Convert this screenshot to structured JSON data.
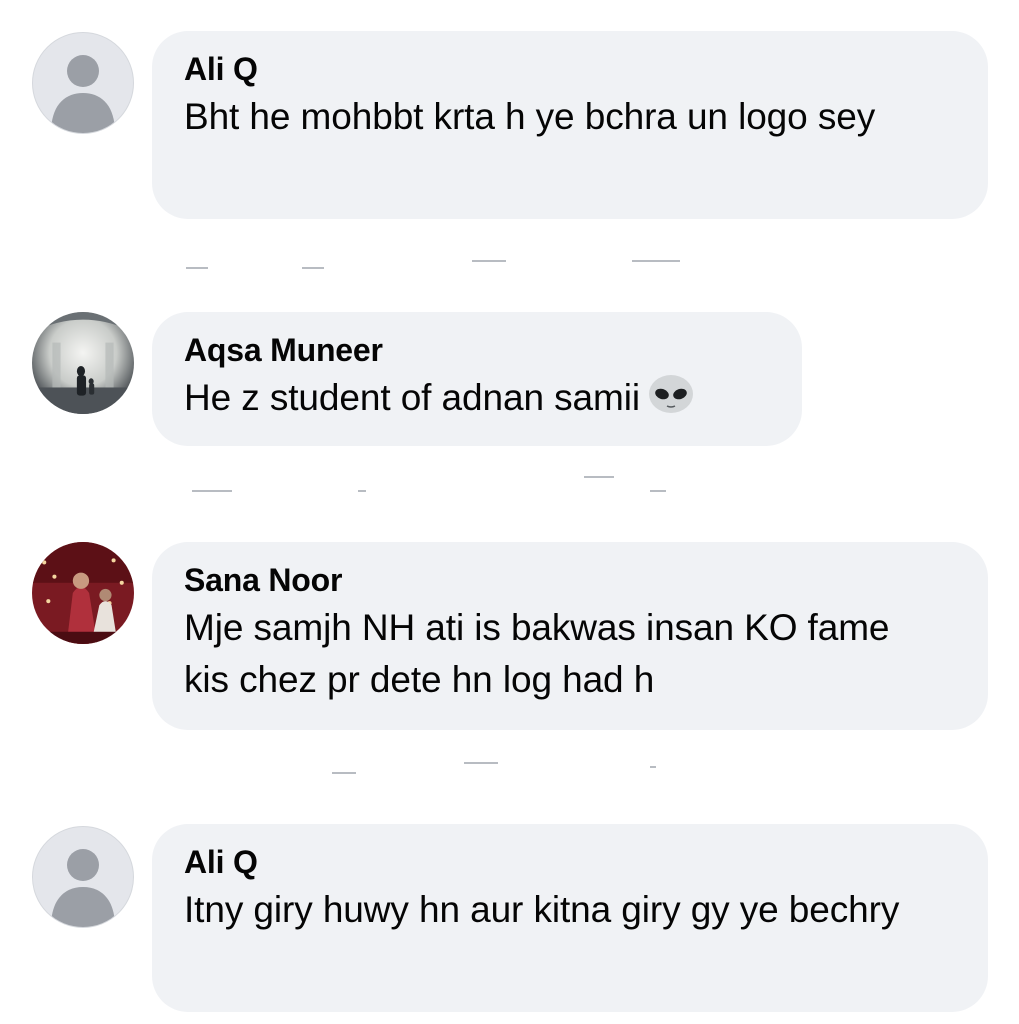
{
  "comments": [
    {
      "author": "Ali Q",
      "text": "Bht he mohbbt krta h ye bchra un logo sey",
      "avatar": "default-avatar-icon"
    },
    {
      "author": "Aqsa Muneer",
      "text": "He z student of adnan samii",
      "emoji": "alien-emoji-icon",
      "avatar": "profile-photo"
    },
    {
      "author": "Sana Noor",
      "text": "Mje samjh NH ati is bakwas insan KO fame kis chez pr dete hn log had h",
      "avatar": "profile-photo"
    },
    {
      "author": "Ali Q",
      "text": "Itny giry huwy hn aur kitna giry gy ye bechry",
      "avatar": "default-avatar-icon"
    }
  ],
  "colors": {
    "bubble_bg": "#f0f2f5",
    "text": "#050505",
    "default_avatar_bg": "#e4e6eb",
    "default_avatar_fg": "#9b9fa6"
  }
}
